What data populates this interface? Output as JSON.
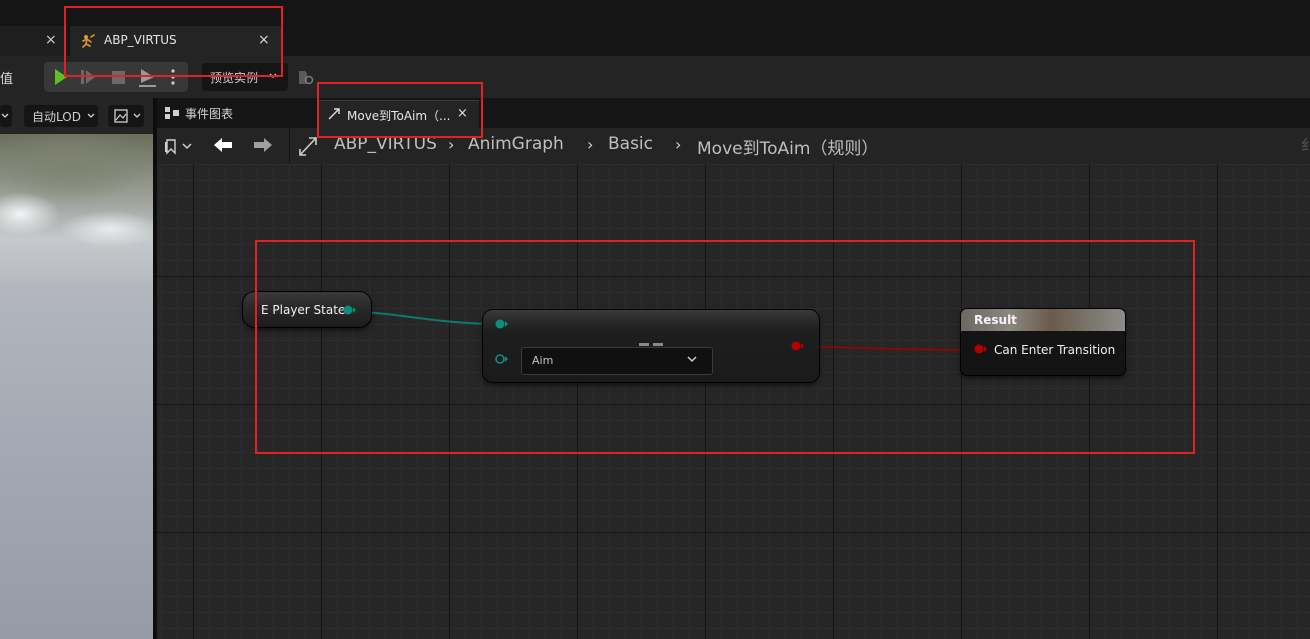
{
  "window": {
    "tabs": [
      {
        "label": "",
        "close": "×"
      },
      {
        "label": "ABP_VIRTUS",
        "close": "×"
      }
    ]
  },
  "toolbar": {
    "value_label": "值",
    "preview_instance": "预览实例"
  },
  "viewport": {
    "auto_lod": "自动LOD"
  },
  "graph_tabs": [
    {
      "label": "事件图表"
    },
    {
      "label": "Move到ToAim（...",
      "close": "×"
    }
  ],
  "breadcrumb": {
    "items": [
      "ABP_VIRTUS",
      "AnimGraph",
      "Basic",
      "Move到ToAim（规则）"
    ],
    "right_mark": "纟"
  },
  "graph": {
    "variable_node": {
      "label": "E Player State"
    },
    "compare_node": {
      "enum_value": "Aim"
    },
    "result_node": {
      "title": "Result",
      "pin": "Can Enter Transition"
    }
  },
  "colors": {
    "enum_wire": "#0b7a6e",
    "bool_wire": "#9c0000",
    "highlight": "#e02227",
    "play_green": "#5fbf24"
  }
}
